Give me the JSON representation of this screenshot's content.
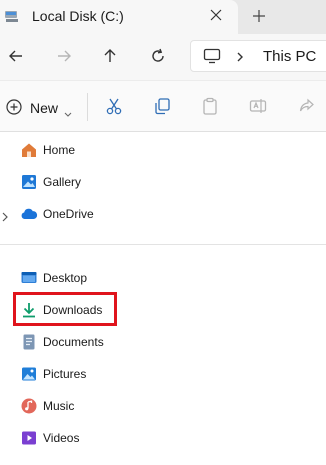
{
  "tab": {
    "title": "Local Disk (C:)"
  },
  "address": {
    "text": "This PC"
  },
  "commandbar": {
    "new_label": "New"
  },
  "sidebar": {
    "items": [
      {
        "label": "Home",
        "icon": "home-icon"
      },
      {
        "label": "Gallery",
        "icon": "gallery-icon"
      },
      {
        "label": "OneDrive",
        "icon": "onedrive-icon"
      },
      {
        "label": "Desktop",
        "icon": "desktop-icon"
      },
      {
        "label": "Downloads",
        "icon": "downloads-icon"
      },
      {
        "label": "Documents",
        "icon": "documents-icon"
      },
      {
        "label": "Pictures",
        "icon": "pictures-icon"
      },
      {
        "label": "Music",
        "icon": "music-icon"
      },
      {
        "label": "Videos",
        "icon": "videos-icon"
      }
    ]
  },
  "colors": {
    "highlight": "#e0141c",
    "accent": "#0067c0"
  }
}
